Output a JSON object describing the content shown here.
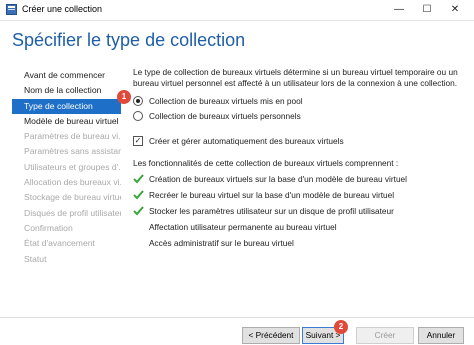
{
  "window": {
    "title": "Créer une collection"
  },
  "heading": "Spécifier le type de collection",
  "nav": [
    {
      "label": "Avant de commencer",
      "state": "normal"
    },
    {
      "label": "Nom de la collection",
      "state": "normal"
    },
    {
      "label": "Type de collection",
      "state": "active"
    },
    {
      "label": "Modèle de bureau virtuel",
      "state": "normal"
    },
    {
      "label": "Paramètres de bureau vi...",
      "state": "disabled"
    },
    {
      "label": "Paramètres sans assistance",
      "state": "disabled"
    },
    {
      "label": "Utilisateurs et groupes d'...",
      "state": "disabled"
    },
    {
      "label": "Allocation des bureaux vi...",
      "state": "disabled"
    },
    {
      "label": "Stockage de bureau virtuel",
      "state": "disabled"
    },
    {
      "label": "Disques de profil utilisateur",
      "state": "disabled"
    },
    {
      "label": "Confirmation",
      "state": "disabled"
    },
    {
      "label": "État d'avancement",
      "state": "disabled"
    },
    {
      "label": "Statut",
      "state": "disabled"
    }
  ],
  "description": "Le type de collection de bureaux virtuels détermine si un bureau virtuel temporaire ou un bureau virtuel personnel est affecté à un utilisateur lors de la connexion à une collection.",
  "options": {
    "pooled": "Collection de bureaux virtuels mis en pool",
    "personal": "Collection de bureaux virtuels personnels",
    "selected": "pooled"
  },
  "auto_create": {
    "label": "Créer et gérer automatiquement des bureaux virtuels",
    "checked": true
  },
  "features": {
    "title": "Les fonctionnalités de cette collection de bureaux virtuels comprennent :",
    "items": [
      {
        "label": "Création de bureaux virtuels sur la base d'un modèle de bureau virtuel",
        "checked": true
      },
      {
        "label": "Recréer le bureau virtuel sur la base d'un modèle de bureau virtuel",
        "checked": true
      },
      {
        "label": "Stocker les paramètres utilisateur sur un disque de profil utilisateur",
        "checked": true
      },
      {
        "label": "Affectation utilisateur permanente au bureau virtuel",
        "checked": false
      },
      {
        "label": "Accès administratif sur le bureau virtuel",
        "checked": false
      }
    ]
  },
  "badges": {
    "step1": "1",
    "step2": "2"
  },
  "buttons": {
    "previous": "< Précédent",
    "next": "Suivant >",
    "create": "Créer",
    "cancel": "Annuler"
  },
  "colors": {
    "accent": "#1e6fc7",
    "heading": "#1f5ea8",
    "badge": "#e04a3a",
    "check": "#3aa63a"
  }
}
